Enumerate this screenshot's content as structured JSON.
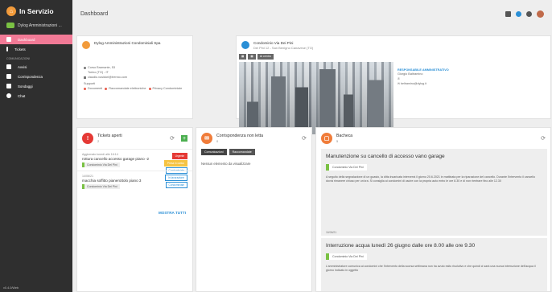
{
  "sidebar": {
    "brand": "In Servizio",
    "org": "Dylog Amministrazioni ...",
    "items": [
      {
        "label": "Dashboard"
      },
      {
        "label": "Tickets"
      }
    ],
    "section": "COMUNICAZIONI",
    "comm_items": [
      {
        "label": "Avvisi"
      },
      {
        "label": "Corrispondenza"
      },
      {
        "label": "Sondaggi"
      },
      {
        "label": "Chat"
      }
    ],
    "version": "v0.4.0/Web"
  },
  "topbar": {
    "title": "Dashboard"
  },
  "admin_card": {
    "name": "Dylog Amministrazioni Condominiali Spa",
    "address": "Corso Bramante, 53",
    "city": "Torino (TO) - IT",
    "email": "claudio.vusidori@trenno.com",
    "support_label": "Supporti",
    "links": [
      "Documenti",
      "Raccomandate elettroniche",
      "Privacy Condominiale"
    ]
  },
  "condo_card": {
    "name": "Condominio Via Dei Pini",
    "address": "Dei Pini 12 - San Benigno Canavese (TO)",
    "tags": [
      "Al centro"
    ],
    "resp_label": "RESPONSABILE AMMINISTRATIVO",
    "resp_name": "Giorgio Baltramino",
    "resp_email": "beltramino@dylog.it"
  },
  "tickets_card": {
    "title": "Tickets aperti",
    "count": "2",
    "tickets": [
      {
        "date": "Aggiornato lunedì alle 16:14",
        "title": "rottura cancello accesso garage piano -2",
        "chip": "Condominio Via Dei Pini",
        "badges": [
          "Urgente",
          "Presa in carico",
          "Condominiale"
        ]
      },
      {
        "date": "14/06/21",
        "title": "macchia soffitto pianerottolo piano 3",
        "chip": "Condominio Via Dei Pini",
        "badges": [
          "In lavorazione",
          "Condominiale"
        ]
      }
    ],
    "show_all": "MOSTRA TUTTI"
  },
  "corr_card": {
    "title": "Corrispondenza non letta",
    "count": "0",
    "tabs": [
      "Comunicazioni",
      "Raccomandate"
    ],
    "empty": "Nessun elemento da visualizzare"
  },
  "bacheca_card": {
    "title": "Bacheca",
    "count": "5",
    "notices": [
      {
        "title": "Manutenzione su cancello di accesso vano garage",
        "chip": "Condominio Via Dei Pini",
        "text": "A seguito della segnalazione di un guasto, la ditta incaricata interverrà il giorno 20.6.2021 in mattinata per la riparazione del cancello. Durante l'intervento il cancello dovrà rimanere chiuso per un'ora. Si consiglia ai condomini di uscire con la propria auto entro le ore 8.30 e di non rientrare fino alle 12.30",
        "date": "16/06/21"
      },
      {
        "title": "Interruzione acqua lunedì 26 giugno dalle ore 8.00 alle ore 9.30",
        "chip": "Condominio Via Dei Pini",
        "text": "L'amministratore comunica ai condomini che l'intervento della scorsa settimana non ha avuto esito risolutivo e che quindi ci sarà una nuova interruzione dell'acqua il giorno indicato in oggetto"
      }
    ]
  },
  "colors": {
    "accent": "#f27a96",
    "sidebar": "#2f2f2f",
    "link": "#2a8fd6"
  }
}
